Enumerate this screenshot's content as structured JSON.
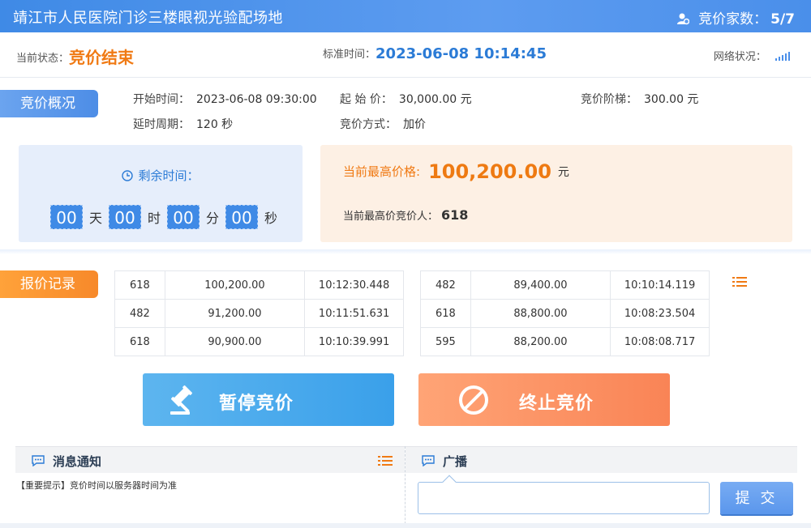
{
  "header": {
    "title": "靖江市人民医院门诊三楼眼视光验配场地",
    "bidders_label": "竞价家数：",
    "bidders_value": "5/7"
  },
  "status": {
    "state_label": "当前状态：",
    "state_value": "竞价结束",
    "time_label": "标准时间：",
    "time_value": "2023-06-08 10:14:45",
    "network_label": "网络状况："
  },
  "overview": {
    "tag": "竞价概况",
    "start_label": "开始时间：",
    "start_value": "2023-06-08 09:30:00",
    "base_label": "起 始 价：",
    "base_value": "30,000.00 元",
    "step_label": "竞价阶梯：",
    "step_value": "300.00 元",
    "delay_label": "延时周期：",
    "delay_value": "120 秒",
    "mode_label": "竞价方式：",
    "mode_value": "加价"
  },
  "countdown": {
    "label": "剩余时间：",
    "days": "00",
    "days_unit": "天",
    "hours": "00",
    "hours_unit": "时",
    "minutes": "00",
    "minutes_unit": "分",
    "seconds": "00",
    "seconds_unit": "秒"
  },
  "highest": {
    "price_label": "当前最高价格:",
    "price_value": "100,200.00",
    "price_unit": "元",
    "bidder_label": "当前最高价竞价人：",
    "bidder_value": "618"
  },
  "records": {
    "tag": "报价记录",
    "left": [
      [
        "618",
        "100,200.00",
        "10:12:30.448"
      ],
      [
        "482",
        "91,200.00",
        "10:11:51.631"
      ],
      [
        "618",
        "90,900.00",
        "10:10:39.991"
      ]
    ],
    "right": [
      [
        "482",
        "89,400.00",
        "10:10:14.119"
      ],
      [
        "618",
        "88,800.00",
        "10:08:23.504"
      ],
      [
        "595",
        "88,200.00",
        "10:08:08.717"
      ]
    ]
  },
  "actions": {
    "pause_label": "暂停竞价",
    "stop_label": "终止竞价"
  },
  "notice": {
    "title": "消息通知",
    "text": "【重要提示】竞价时间以服务器时间为准"
  },
  "broadcast": {
    "title": "广播",
    "input_value": "",
    "submit_label": "提 交"
  },
  "colors": {
    "primary_blue": "#3f8ae6",
    "accent_orange": "#f07a14",
    "pause_button": "#3aa0ea",
    "stop_button": "#f98456"
  },
  "icons": [
    "user-icon",
    "signal-icon",
    "clock-icon",
    "list-icon",
    "gavel-icon",
    "prohibit-icon",
    "chat-icon"
  ]
}
